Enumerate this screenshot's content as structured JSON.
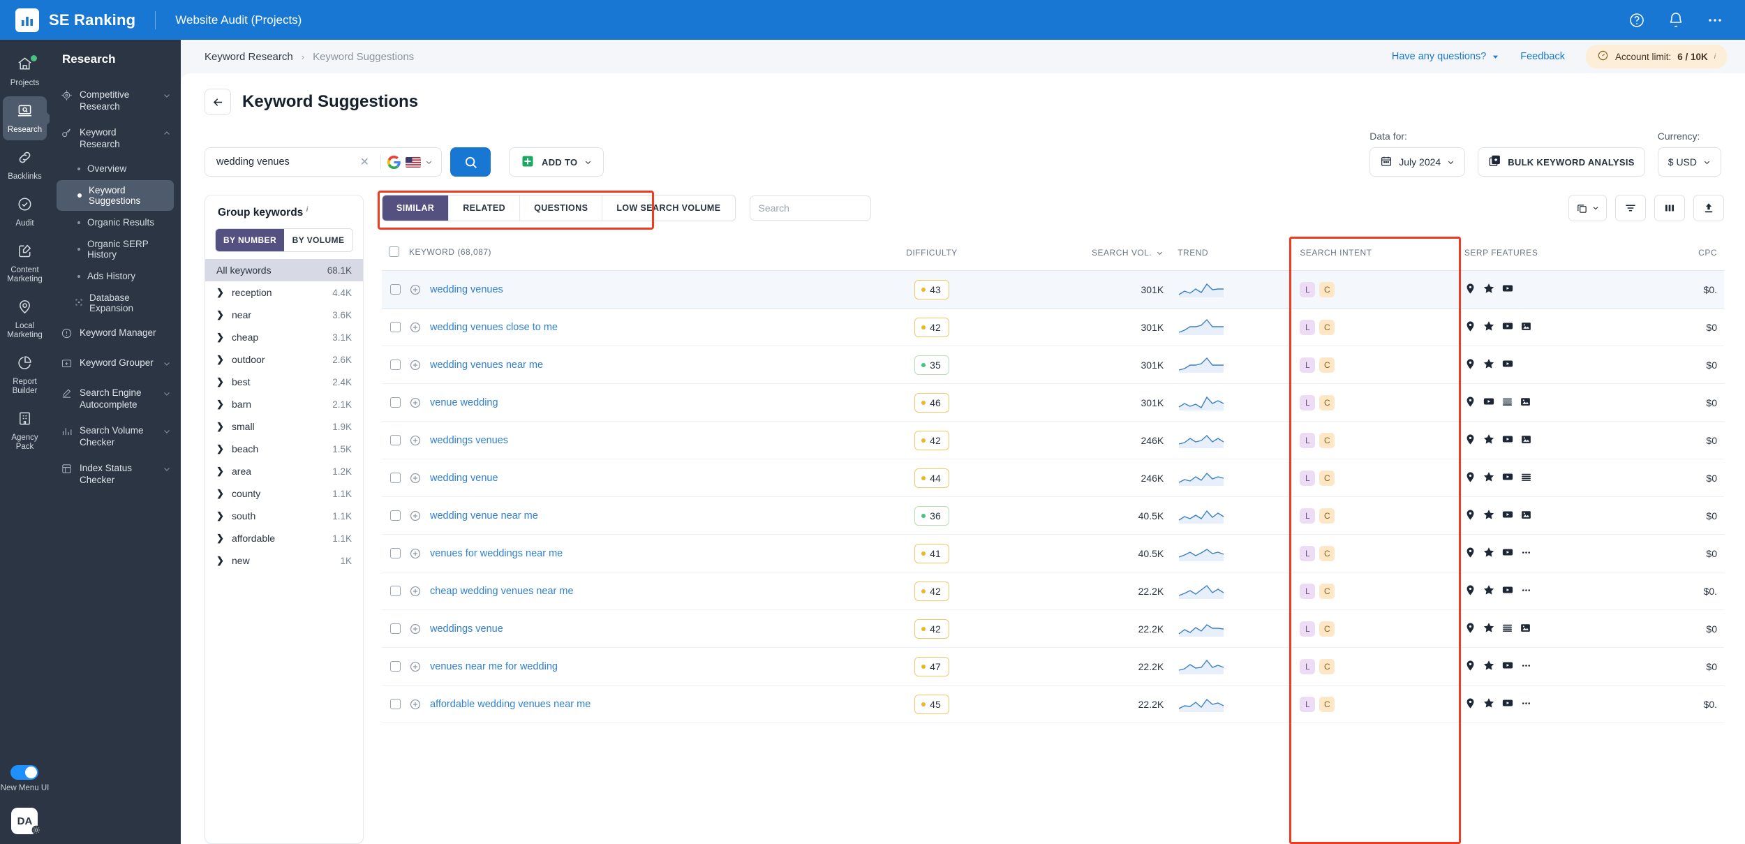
{
  "topbar": {
    "brand": "SE Ranking",
    "section": "Website Audit (Projects)",
    "icons": [
      "help-circle-icon",
      "bell-icon",
      "more-horizontal-icon"
    ]
  },
  "rail": {
    "items": [
      {
        "label": "Projects",
        "icon": "home-icon",
        "active": false,
        "badge": true
      },
      {
        "label": "Research",
        "icon": "monitor-search-icon",
        "active": true,
        "badge": false
      },
      {
        "label": "Backlinks",
        "icon": "link-icon",
        "active": false,
        "badge": false
      },
      {
        "label": "Audit",
        "icon": "check-circle-icon",
        "active": false,
        "badge": false
      },
      {
        "label": "Content Marketing",
        "icon": "edit-square-icon",
        "active": false,
        "badge": false
      },
      {
        "label": "Local Marketing",
        "icon": "map-pin-icon",
        "active": false,
        "badge": false
      },
      {
        "label": "Report Builder",
        "icon": "pie-chart-icon",
        "active": false,
        "badge": false
      },
      {
        "label": "Agency Pack",
        "icon": "building-icon",
        "active": false,
        "badge": false
      }
    ],
    "toggle_label": "New Menu UI",
    "avatar_initials": "DA"
  },
  "subnav": {
    "title": "Research",
    "groups": [
      {
        "label": "Competitive Research",
        "icon": "target-icon",
        "chevron": "chevron-down",
        "children": []
      },
      {
        "label": "Keyword Research",
        "icon": "key-icon",
        "chevron": "chevron-up",
        "children": [
          {
            "label": "Overview",
            "active": false
          },
          {
            "label": "Keyword Suggestions",
            "active": true
          },
          {
            "label": "Organic Results",
            "active": false
          },
          {
            "label": "Organic SERP History",
            "active": false
          },
          {
            "label": "Ads History",
            "active": false
          },
          {
            "label": "Database Expansion",
            "active": false,
            "icon": "expand-icon"
          }
        ]
      },
      {
        "label": "Keyword Manager",
        "icon": "info-circle-icon",
        "chevron": "",
        "children": []
      },
      {
        "label": "Keyword Grouper",
        "icon": "folder-plus-icon",
        "chevron": "chevron-down",
        "children": []
      },
      {
        "label": "Search Engine Autocomplete",
        "icon": "pen-icon",
        "chevron": "chevron-down",
        "children": []
      },
      {
        "label": "Search Volume Checker",
        "icon": "bar-chart-icon",
        "chevron": "chevron-down",
        "children": []
      },
      {
        "label": "Index Status Checker",
        "icon": "layers-icon",
        "chevron": "chevron-down",
        "children": []
      }
    ]
  },
  "breadcrumb": {
    "parent": "Keyword Research",
    "current": "Keyword Suggestions",
    "questions_link": "Have any questions?",
    "feedback_link": "Feedback",
    "account_limit_label": "Account limit:",
    "account_limit_value": "6 / 10K"
  },
  "page": {
    "title": "Keyword Suggestions",
    "search_value": "wedding venues",
    "search_engine": "google-icon",
    "country_flag": "us-flag-icon",
    "add_to_label": "ADD TO",
    "data_for_label": "Data for:",
    "data_for_value": "July 2024",
    "bulk_label": "BULK KEYWORD ANALYSIS",
    "currency_label": "Currency:",
    "currency_value": "$ USD"
  },
  "group_panel": {
    "title": "Group keywords",
    "toggle": [
      {
        "label": "BY NUMBER",
        "active": true
      },
      {
        "label": "BY VOLUME",
        "active": false
      }
    ],
    "all_label": "All keywords",
    "all_count": "68.1K",
    "rows": [
      {
        "name": "reception",
        "count": "4.4K"
      },
      {
        "name": "near",
        "count": "3.6K"
      },
      {
        "name": "cheap",
        "count": "3.1K"
      },
      {
        "name": "outdoor",
        "count": "2.6K"
      },
      {
        "name": "best",
        "count": "2.4K"
      },
      {
        "name": "barn",
        "count": "2.1K"
      },
      {
        "name": "small",
        "count": "1.9K"
      },
      {
        "name": "beach",
        "count": "1.5K"
      },
      {
        "name": "area",
        "count": "1.2K"
      },
      {
        "name": "county",
        "count": "1.1K"
      },
      {
        "name": "south",
        "count": "1.1K"
      },
      {
        "name": "affordable",
        "count": "1.1K"
      },
      {
        "name": "new",
        "count": "1K"
      }
    ]
  },
  "table": {
    "tabs": [
      {
        "label": "SIMILAR",
        "active": true
      },
      {
        "label": "RELATED",
        "active": false
      },
      {
        "label": "QUESTIONS",
        "active": false
      },
      {
        "label": "LOW SEARCH VOLUME",
        "active": false
      }
    ],
    "search_placeholder": "Search",
    "search_value": "",
    "tools": [
      "copy-dropdown-icon",
      "filter-icon",
      "columns-icon",
      "export-icon"
    ],
    "columns": [
      "KEYWORD (68,087)",
      "DIFFICULTY",
      "SEARCH VOL.",
      "TREND",
      "SEARCH INTENT",
      "SERP FEATURES",
      "CPC"
    ],
    "rows": [
      {
        "keyword": "wedding venues",
        "difficulty": "43",
        "difficulty_color": "yellow",
        "volume": "301K",
        "intent": [
          "L",
          "C"
        ],
        "serp": [
          "map-pin-icon",
          "star-icon",
          "video-icon"
        ],
        "cpc": "$0.",
        "highlight": true
      },
      {
        "keyword": "wedding venues close to me",
        "difficulty": "42",
        "difficulty_color": "yellow",
        "volume": "301K",
        "intent": [
          "L",
          "C"
        ],
        "serp": [
          "map-pin-icon",
          "star-icon",
          "video-icon",
          "image-icon"
        ],
        "cpc": "$0",
        "highlight": false
      },
      {
        "keyword": "wedding venues near me",
        "difficulty": "35",
        "difficulty_color": "green",
        "volume": "301K",
        "intent": [
          "L",
          "C"
        ],
        "serp": [
          "map-pin-icon",
          "star-icon",
          "video-icon"
        ],
        "cpc": "$0",
        "highlight": false
      },
      {
        "keyword": "venue wedding",
        "difficulty": "46",
        "difficulty_color": "yellow",
        "volume": "301K",
        "intent": [
          "L",
          "C"
        ],
        "serp": [
          "map-pin-icon",
          "video-icon",
          "list-icon",
          "image-icon"
        ],
        "cpc": "$0",
        "highlight": false
      },
      {
        "keyword": "weddings venues",
        "difficulty": "42",
        "difficulty_color": "yellow",
        "volume": "246K",
        "intent": [
          "L",
          "C"
        ],
        "serp": [
          "map-pin-icon",
          "star-icon",
          "video-icon",
          "image-icon"
        ],
        "cpc": "$0",
        "highlight": false
      },
      {
        "keyword": "wedding venue",
        "difficulty": "44",
        "difficulty_color": "yellow",
        "volume": "246K",
        "intent": [
          "L",
          "C"
        ],
        "serp": [
          "map-pin-icon",
          "star-icon",
          "video-icon",
          "list-icon"
        ],
        "cpc": "$0",
        "highlight": false
      },
      {
        "keyword": "wedding venue near me",
        "difficulty": "36",
        "difficulty_color": "green",
        "volume": "40.5K",
        "intent": [
          "L",
          "C"
        ],
        "serp": [
          "map-pin-icon",
          "star-icon",
          "video-icon",
          "image-icon"
        ],
        "cpc": "$0",
        "highlight": false
      },
      {
        "keyword": "venues for weddings near me",
        "difficulty": "41",
        "difficulty_color": "yellow",
        "volume": "40.5K",
        "intent": [
          "L",
          "C"
        ],
        "serp": [
          "map-pin-icon",
          "star-icon",
          "video-icon",
          "more-icon"
        ],
        "cpc": "$0",
        "highlight": false
      },
      {
        "keyword": "cheap wedding venues near me",
        "difficulty": "42",
        "difficulty_color": "yellow",
        "volume": "22.2K",
        "intent": [
          "L",
          "C"
        ],
        "serp": [
          "map-pin-icon",
          "star-icon",
          "video-icon",
          "more-icon"
        ],
        "cpc": "$0.",
        "highlight": false
      },
      {
        "keyword": "weddings venue",
        "difficulty": "42",
        "difficulty_color": "yellow",
        "volume": "22.2K",
        "intent": [
          "L",
          "C"
        ],
        "serp": [
          "map-pin-icon",
          "star-icon",
          "list-icon",
          "image-icon"
        ],
        "cpc": "$0",
        "highlight": false
      },
      {
        "keyword": "venues near me for wedding",
        "difficulty": "47",
        "difficulty_color": "yellow",
        "volume": "22.2K",
        "intent": [
          "L",
          "C"
        ],
        "serp": [
          "map-pin-icon",
          "star-icon",
          "video-icon",
          "more-icon"
        ],
        "cpc": "$0",
        "highlight": false
      },
      {
        "keyword": "affordable wedding venues near me",
        "difficulty": "45",
        "difficulty_color": "yellow",
        "volume": "22.2K",
        "intent": [
          "L",
          "C"
        ],
        "serp": [
          "map-pin-icon",
          "star-icon",
          "video-icon",
          "more-icon"
        ],
        "cpc": "$0.",
        "highlight": false
      }
    ]
  },
  "colors": {
    "brand_blue": "#1877d2",
    "sidebar_dark": "#2b3543",
    "accent_purple": "#545180",
    "highlight_red": "#ef3b1f",
    "link_blue": "#2f7fd4"
  }
}
